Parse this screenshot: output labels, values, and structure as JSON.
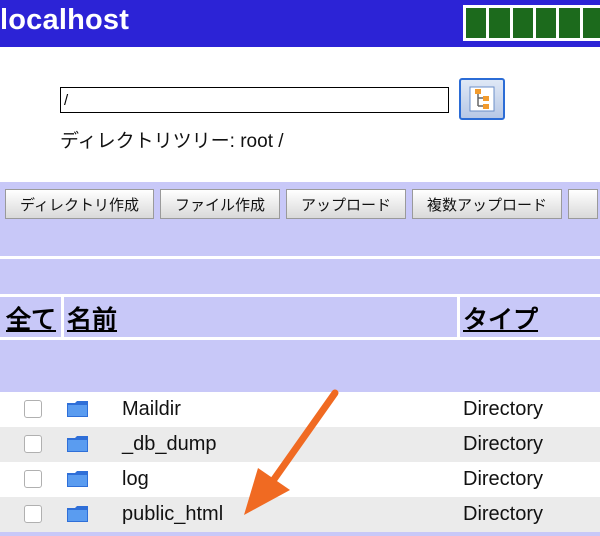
{
  "header": {
    "title": "localhost",
    "header_bg": "#2c23d6",
    "meter_color": "#1c6a1c"
  },
  "path": {
    "value": "/",
    "tree_caption": "ディレクトリツリー: root /"
  },
  "toolbar": {
    "buttons": [
      "ディレクトリ作成",
      "ファイル作成",
      "アップロード",
      "複数アップロード"
    ]
  },
  "columns": {
    "all": "全て",
    "name": "名前",
    "type": "タイプ"
  },
  "files": [
    {
      "name": "Maildir",
      "type": "Directory"
    },
    {
      "name": "_db_dump",
      "type": "Directory"
    },
    {
      "name": "log",
      "type": "Directory"
    },
    {
      "name": "public_html",
      "type": "Directory"
    }
  ],
  "colors": {
    "panel": "#c8c8f8",
    "row_alt": "#ebebeb",
    "annotation_arrow": "#f06a22"
  }
}
